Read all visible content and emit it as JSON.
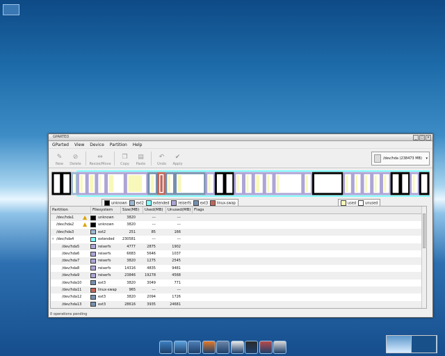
{
  "window": {
    "title": "GPARTED"
  },
  "menu": [
    "GParted",
    "View",
    "Device",
    "Partition",
    "Help"
  ],
  "toolbar": {
    "new": "New",
    "delete": "Delete",
    "resize": "Resize/Move",
    "copy": "Copy",
    "paste": "Paste",
    "undo": "Undo",
    "apply": "Apply"
  },
  "device": "/dev/hda (238473 MB)",
  "legend": {
    "fs": [
      {
        "label": "unknown",
        "color": "#000000"
      },
      {
        "label": "ext2",
        "color": "#9db8d2"
      },
      {
        "label": "extended",
        "color": "#7dfcfe"
      },
      {
        "label": "reiserfs",
        "color": "#ada5d6"
      },
      {
        "label": "ext3",
        "color": "#7590ae"
      },
      {
        "label": "linux-swap",
        "color": "#c1665a"
      }
    ],
    "usage": [
      {
        "label": "used",
        "color": "#f8f8ba"
      },
      {
        "label": "unused",
        "color": "#ffffff"
      }
    ]
  },
  "columns": [
    "Partition",
    "Filesystem",
    "Size(MB)",
    "Used(MB)",
    "Unused(MB)",
    "Flags"
  ],
  "rows": [
    {
      "partition": "/dev/hda1",
      "fs": "unknown",
      "color": "#000000",
      "size": "3820",
      "used": "---",
      "unused": "---",
      "warn": true,
      "indent": false,
      "expander": false
    },
    {
      "partition": "/dev/hda2",
      "fs": "unknown",
      "color": "#000000",
      "size": "3820",
      "used": "---",
      "unused": "---",
      "warn": true,
      "indent": false,
      "expander": false
    },
    {
      "partition": "/dev/hda3",
      "fs": "ext2",
      "color": "#9db8d2",
      "size": "251",
      "used": "85",
      "unused": "166",
      "warn": false,
      "indent": false,
      "expander": false
    },
    {
      "partition": "/dev/hda4",
      "fs": "extended",
      "color": "#7dfcfe",
      "size": "230581",
      "used": "---",
      "unused": "---",
      "warn": false,
      "indent": false,
      "expander": true
    },
    {
      "partition": "/dev/hda5",
      "fs": "reiserfs",
      "color": "#ada5d6",
      "size": "4777",
      "used": "2875",
      "unused": "1902",
      "warn": false,
      "indent": true,
      "expander": false
    },
    {
      "partition": "/dev/hda6",
      "fs": "reiserfs",
      "color": "#ada5d6",
      "size": "6683",
      "used": "5646",
      "unused": "1037",
      "warn": false,
      "indent": true,
      "expander": false
    },
    {
      "partition": "/dev/hda7",
      "fs": "reiserfs",
      "color": "#ada5d6",
      "size": "3820",
      "used": "1275",
      "unused": "2545",
      "warn": false,
      "indent": true,
      "expander": false
    },
    {
      "partition": "/dev/hda8",
      "fs": "reiserfs",
      "color": "#ada5d6",
      "size": "14316",
      "used": "4835",
      "unused": "9481",
      "warn": false,
      "indent": true,
      "expander": false
    },
    {
      "partition": "/dev/hda9",
      "fs": "reiserfs",
      "color": "#ada5d6",
      "size": "23846",
      "used": "19278",
      "unused": "4568",
      "warn": false,
      "indent": true,
      "expander": false
    },
    {
      "partition": "/dev/hda10",
      "fs": "ext3",
      "color": "#7590ae",
      "size": "3820",
      "used": "3049",
      "unused": "771",
      "warn": false,
      "indent": true,
      "expander": false
    },
    {
      "partition": "/dev/hda11",
      "fs": "linux-swap",
      "color": "#c1665a",
      "size": "965",
      "used": "---",
      "unused": "---",
      "warn": false,
      "indent": true,
      "expander": false
    },
    {
      "partition": "/dev/hda12",
      "fs": "ext3",
      "color": "#7590ae",
      "size": "3820",
      "used": "2094",
      "unused": "1726",
      "warn": false,
      "indent": true,
      "expander": false
    },
    {
      "partition": "/dev/hda13",
      "fs": "ext3",
      "color": "#7590ae",
      "size": "28616",
      "used": "3935",
      "unused": "24681",
      "warn": false,
      "indent": true,
      "expander": false
    }
  ],
  "status": "0 operations pending",
  "disk_segments": [
    {
      "fs": "unknown",
      "used": 0,
      "ext": false,
      "w": 1
    },
    {
      "fs": "unknown",
      "used": 0,
      "ext": false,
      "w": 1
    },
    {
      "fs": "ext2",
      "used": 0.34,
      "ext": false,
      "w": 0.6
    },
    {
      "fs": "reiserfs",
      "used": 0.6,
      "ext": true,
      "w": 1
    },
    {
      "fs": "reiserfs",
      "used": 0.84,
      "ext": true,
      "w": 1
    },
    {
      "fs": "reiserfs",
      "used": 0.33,
      "ext": true,
      "w": 1
    },
    {
      "fs": "reiserfs",
      "used": 0.34,
      "ext": true,
      "w": 2.2
    },
    {
      "fs": "reiserfs",
      "used": 0.81,
      "ext": true,
      "w": 2.6
    },
    {
      "fs": "ext3",
      "used": 0.8,
      "ext": true,
      "w": 1
    },
    {
      "fs": "linux-swap",
      "used": 1,
      "ext": true,
      "w": 0.8
    },
    {
      "fs": "ext3",
      "used": 0.55,
      "ext": true,
      "w": 1
    },
    {
      "fs": "ext3",
      "used": 0.14,
      "ext": true,
      "w": 3.6
    },
    {
      "fs": "reiserfs",
      "used": 0.5,
      "ext": true,
      "w": 1
    },
    {
      "fs": "unknown",
      "used": 0,
      "ext": true,
      "w": 1
    },
    {
      "fs": "unknown",
      "used": 0,
      "ext": true,
      "w": 1
    },
    {
      "fs": "reiserfs",
      "used": 0.5,
      "ext": true,
      "w": 1
    },
    {
      "fs": "reiserfs",
      "used": 0.5,
      "ext": true,
      "w": 1
    },
    {
      "fs": "reiserfs",
      "used": 0.6,
      "ext": true,
      "w": 1.2
    },
    {
      "fs": "reiserfs",
      "used": 0.5,
      "ext": true,
      "w": 1
    },
    {
      "fs": "reiserfs",
      "used": 0.1,
      "ext": true,
      "w": 3.4
    },
    {
      "fs": "reiserfs",
      "used": 0.5,
      "ext": true,
      "w": 1
    },
    {
      "fs": "unknown",
      "used": 0,
      "ext": true,
      "w": 3.6
    },
    {
      "fs": "reiserfs",
      "used": 0.5,
      "ext": true,
      "w": 1
    },
    {
      "fs": "reiserfs",
      "used": 0.5,
      "ext": true,
      "w": 1
    },
    {
      "fs": "reiserfs",
      "used": 0.5,
      "ext": true,
      "w": 1
    },
    {
      "fs": "reiserfs",
      "used": 0.5,
      "ext": true,
      "w": 1
    },
    {
      "fs": "reiserfs",
      "used": 0.5,
      "ext": true,
      "w": 1
    },
    {
      "fs": "unknown",
      "used": 0,
      "ext": true,
      "w": 1
    },
    {
      "fs": "unknown",
      "used": 0,
      "ext": true,
      "w": 1
    },
    {
      "fs": "reiserfs",
      "used": 0.5,
      "ext": true,
      "w": 1
    },
    {
      "fs": "unknown",
      "used": 0,
      "ext": true,
      "w": 1
    }
  ],
  "panel_icons": [
    "monitor-icon",
    "globe-icon",
    "file-manager-icon",
    "firefox-icon",
    "settings-icon",
    "media-icon",
    "terminal-icon",
    "tools-icon",
    "packages-icon"
  ],
  "colors": {
    "used_fill": "#f8f8ba",
    "extended_border": "#7dfcfe"
  }
}
